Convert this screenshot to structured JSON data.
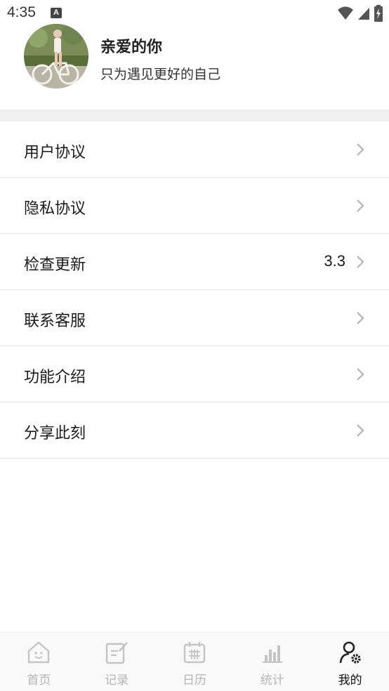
{
  "status_bar": {
    "time": "4:35",
    "notification_letter": "A",
    "icons": [
      "wifi-icon",
      "signal-icon",
      "battery-charging-icon"
    ]
  },
  "profile": {
    "name": "亲爱的你",
    "motto": "只为遇见更好的自己"
  },
  "menu": {
    "items": [
      {
        "label": "用户协议",
        "value": ""
      },
      {
        "label": "隐私协议",
        "value": ""
      },
      {
        "label": "检查更新",
        "value": "3.3"
      },
      {
        "label": "联系客服",
        "value": ""
      },
      {
        "label": "功能介绍",
        "value": ""
      },
      {
        "label": "分享此刻",
        "value": ""
      }
    ]
  },
  "tabbar": {
    "tabs": [
      {
        "label": "首页",
        "icon": "home-icon",
        "active": false
      },
      {
        "label": "记录",
        "icon": "note-edit-icon",
        "active": false
      },
      {
        "label": "日历",
        "icon": "calendar-icon",
        "active": false
      },
      {
        "label": "统计",
        "icon": "bar-chart-icon",
        "active": false
      },
      {
        "label": "我的",
        "icon": "user-settings-icon",
        "active": true
      }
    ]
  },
  "colors": {
    "inactive": "#b5b5b5",
    "active": "#111111",
    "separator": "#f0f0f0",
    "divider": "#e8e8e8"
  }
}
